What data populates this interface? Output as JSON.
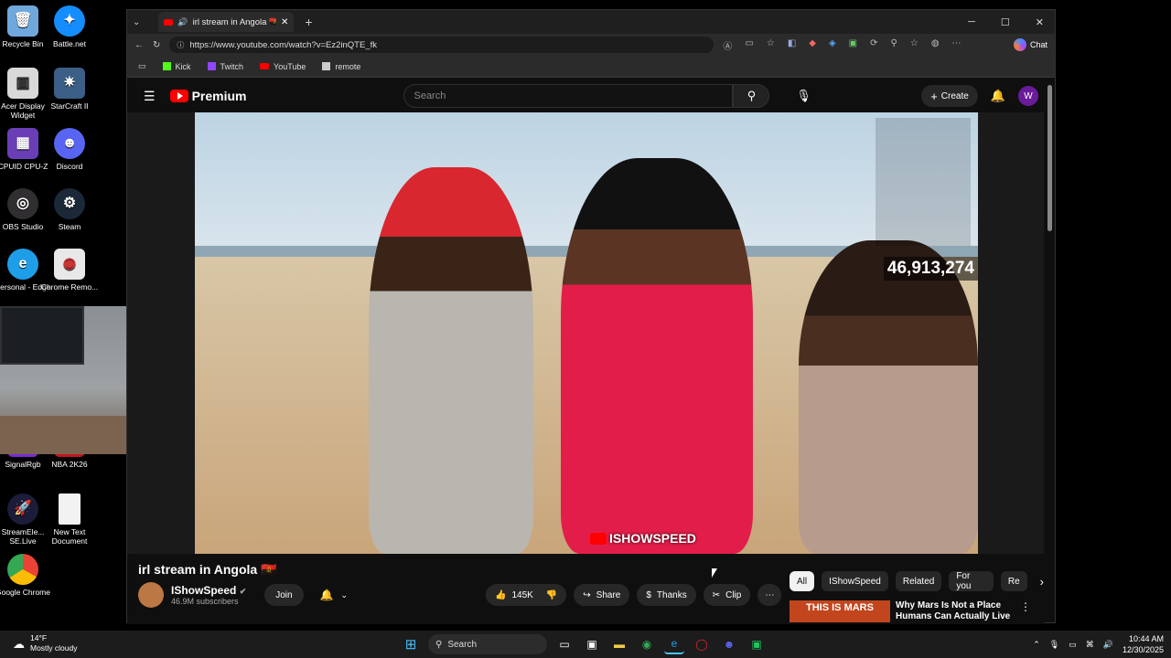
{
  "desktop_icons": [
    {
      "label": "Recycle Bin",
      "icon": "recycle-bin-icon",
      "color": "#6fa8dc"
    },
    {
      "label": "Battle.net",
      "icon": "battlenet-icon",
      "color": "#148eff"
    },
    {
      "label": "Acer Display Widget",
      "icon": "acer-widget-icon",
      "color": "#d9d9d9"
    },
    {
      "label": "StarCraft II",
      "icon": "starcraft-icon",
      "color": "#3b5f86"
    },
    {
      "label": "CPUID CPU-Z",
      "icon": "cpuz-icon",
      "color": "#6a3fb5"
    },
    {
      "label": "Discord",
      "icon": "discord-icon",
      "color": "#5865f2"
    },
    {
      "label": "OBS Studio",
      "icon": "obs-icon",
      "color": "#302e31"
    },
    {
      "label": "Steam",
      "icon": "steam-icon",
      "color": "#1b2838"
    },
    {
      "label": "Personal - Edge",
      "icon": "edge-icon",
      "color": "#1f9ee8"
    },
    {
      "label": "Chrome Remo...",
      "icon": "chrome-remote-icon",
      "color": "#e8e8e8"
    },
    {
      "label": "SignalRgb",
      "icon": "signalrgb-icon",
      "color": "#7a2bd1"
    },
    {
      "label": "NBA 2K26",
      "icon": "nba2k-icon",
      "color": "#c2161e"
    },
    {
      "label": "StreamEle... SE.Live",
      "icon": "streamelements-icon",
      "color": "#1c1c3a"
    },
    {
      "label": "New Text Document",
      "icon": "text-document-icon",
      "color": "#f2f2f2"
    },
    {
      "label": "Google Chrome",
      "icon": "chrome-icon",
      "color": "#34a853"
    }
  ],
  "browser": {
    "tab_title": "irl stream in Angola 🇦🇴 - YouT",
    "url": "https://www.youtube.com/watch?v=Ez2inQTE_fk",
    "chat_label": "Chat",
    "favorites": [
      {
        "label": "Kick",
        "color": "#53fc18"
      },
      {
        "label": "Twitch",
        "color": "#9146ff"
      },
      {
        "label": "YouTube",
        "color": "#ff0000"
      },
      {
        "label": "remote",
        "color": "#cccccc"
      }
    ]
  },
  "youtube": {
    "logo_text": "Premium",
    "search_placeholder": "Search",
    "create_label": "Create",
    "avatar_letter": "W",
    "video": {
      "counter": "46,913,274",
      "watermark": "ISHOWSPEED"
    },
    "title": "irl stream in Angola 🇦🇴",
    "channel": {
      "name": "IShowSpeed",
      "subscribers": "46.9M subscribers",
      "join_label": "Join"
    },
    "actions": {
      "likes": "145K",
      "share": "Share",
      "thanks": "Thanks",
      "clip": "Clip"
    },
    "chips": [
      "All",
      "IShowSpeed",
      "Related",
      "For you",
      "Re"
    ],
    "recommendation": {
      "thumb_text": "THIS IS MARS",
      "title": "Why Mars Is Not a Place Humans Can Actually Live"
    }
  },
  "taskbar": {
    "weather_temp": "14°F",
    "weather_desc": "Mostly cloudy",
    "search_label": "Search",
    "time": "10:44 AM",
    "date": "12/30/2025"
  }
}
